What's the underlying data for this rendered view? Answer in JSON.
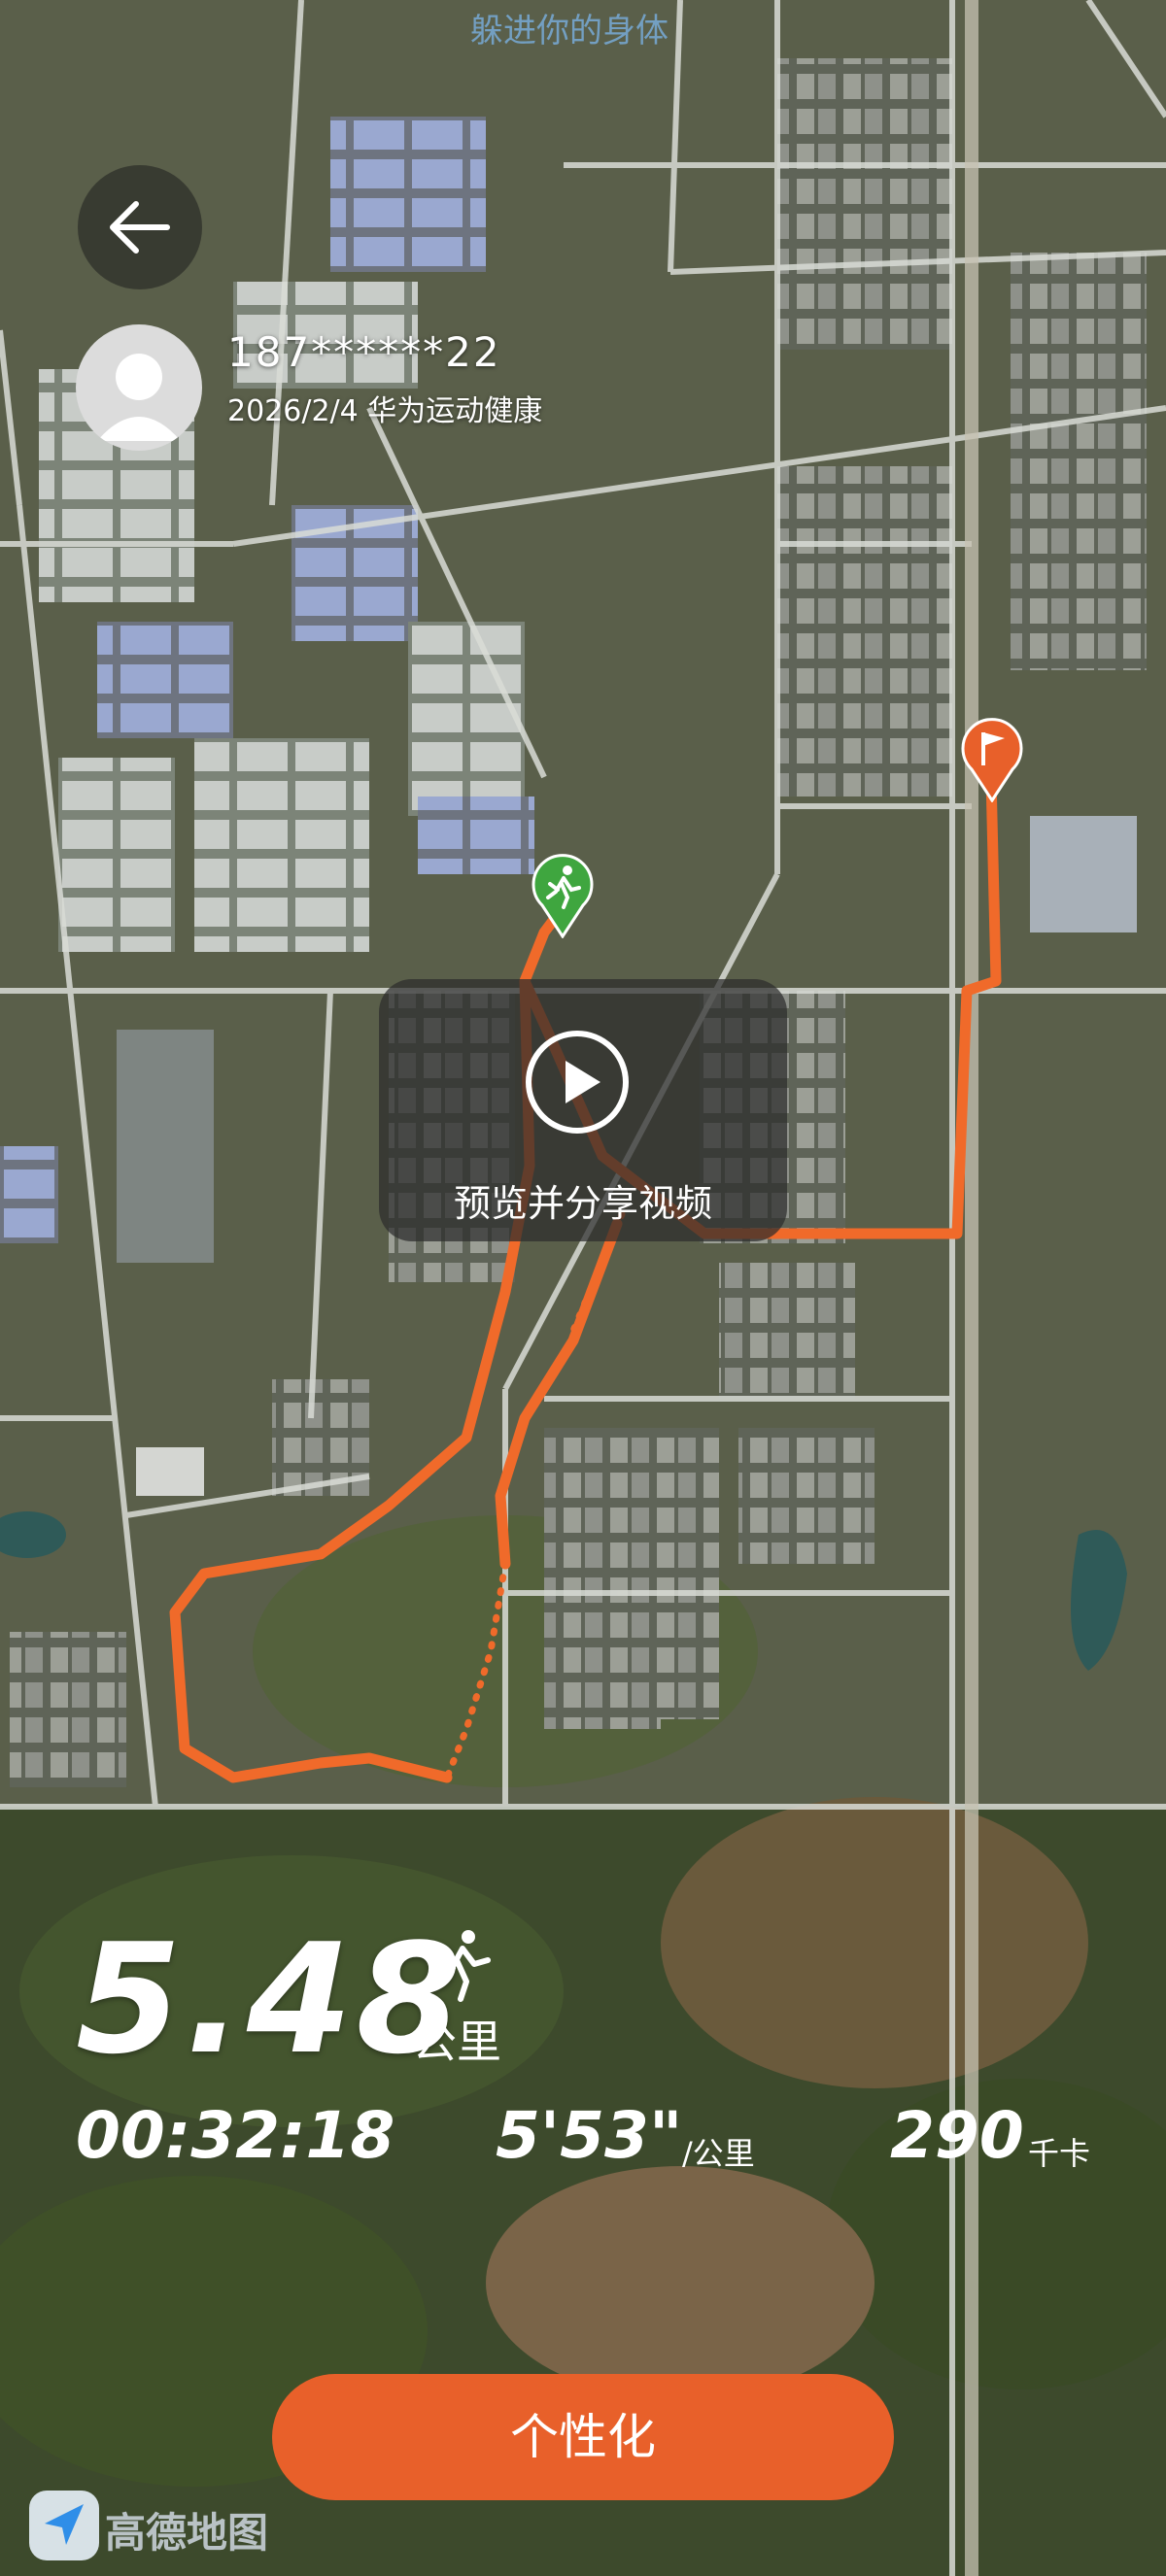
{
  "banner": {
    "text": "躲进你的身体"
  },
  "user": {
    "name": "187******22",
    "meta": "2026/2/4 华为运动健康"
  },
  "video": {
    "label": "预览并分享视频"
  },
  "stats": {
    "distance": "5.48",
    "distance_unit": "公里",
    "duration": "00:32:18",
    "pace": "5'53\"",
    "pace_unit": "/公里",
    "calories": "290",
    "calories_unit": "千卡"
  },
  "actions": {
    "personalize_label": "个性化"
  },
  "watermark": {
    "text": "高德地图"
  },
  "colors": {
    "accent": "#e8602a",
    "route": "#f06a2a",
    "start_marker": "#3fa63f",
    "end_marker": "#e8602a"
  },
  "icons": {
    "back": "arrow-left-icon",
    "avatar": "person-icon",
    "play": "play-icon",
    "runner": "runner-icon",
    "start": "start-runner-marker-icon",
    "finish": "finish-flag-marker-icon",
    "map_logo": "amap-logo-icon"
  }
}
